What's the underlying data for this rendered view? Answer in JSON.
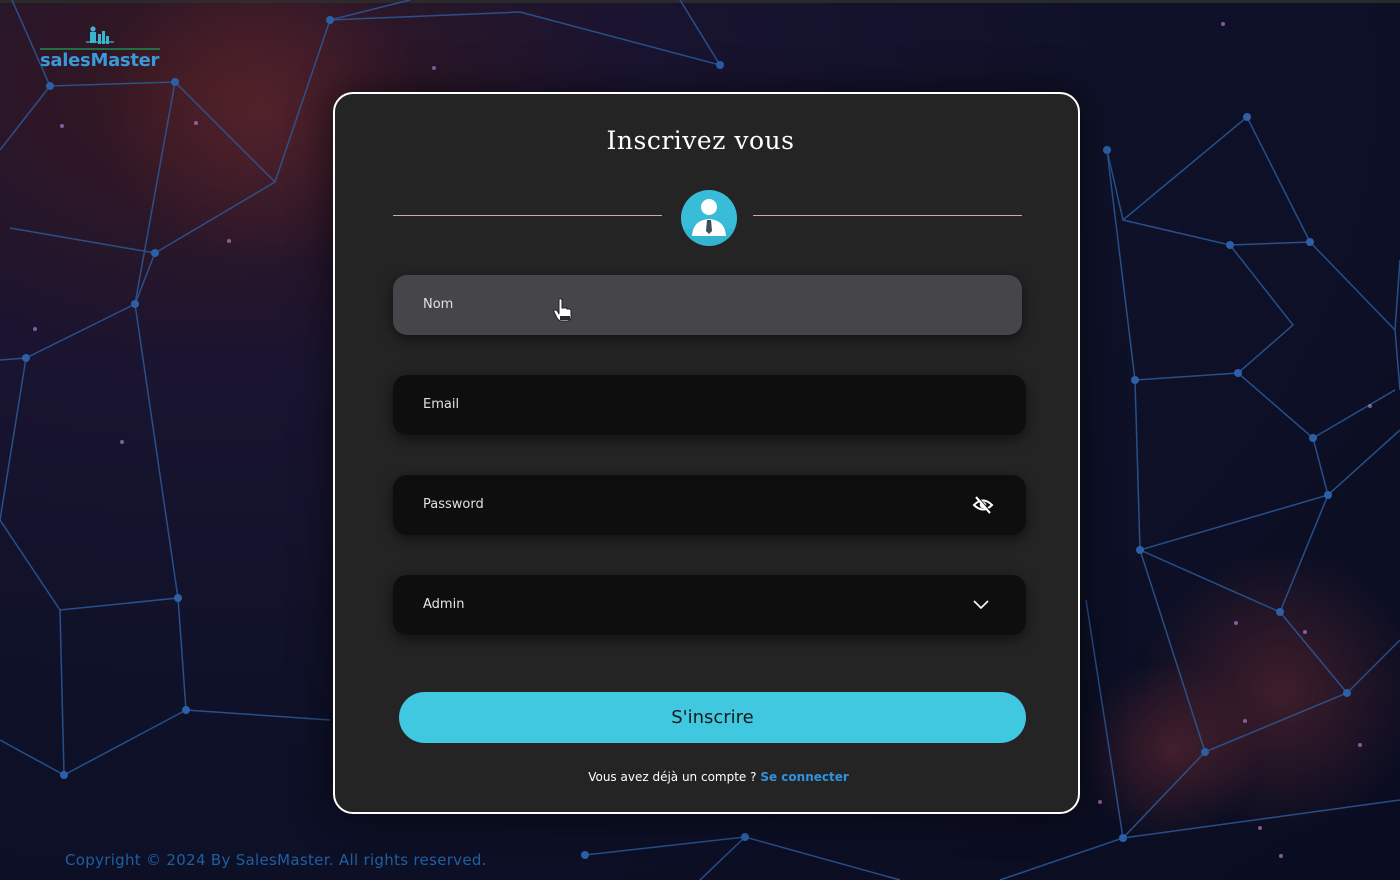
{
  "logo": {
    "text": "salesMaster"
  },
  "form": {
    "title": "Inscrivez vous",
    "name_placeholder": "Nom",
    "email_placeholder": "Email",
    "password_placeholder": "Password",
    "role_value": "Admin",
    "submit_label": "S'inscrire",
    "signin_prompt": "Vous avez déjà un compte ?",
    "signin_link": "Se connecter"
  },
  "footer": {
    "text": "Copyright © 2024 By SalesMaster. All rights reserved."
  },
  "icons": {
    "avatar": "user-avatar-icon",
    "password_toggle": "eye-off-icon",
    "role_dropdown": "chevron-down-icon",
    "cursor": "hand-pointer-icon"
  },
  "colors": {
    "accent": "#3fc8e0",
    "link": "#2f93e0",
    "card_bg": "#242424",
    "field_bg": "#0f0e0f",
    "active_field_bg": "#45454a",
    "footer_text": "#1f5fa0"
  }
}
